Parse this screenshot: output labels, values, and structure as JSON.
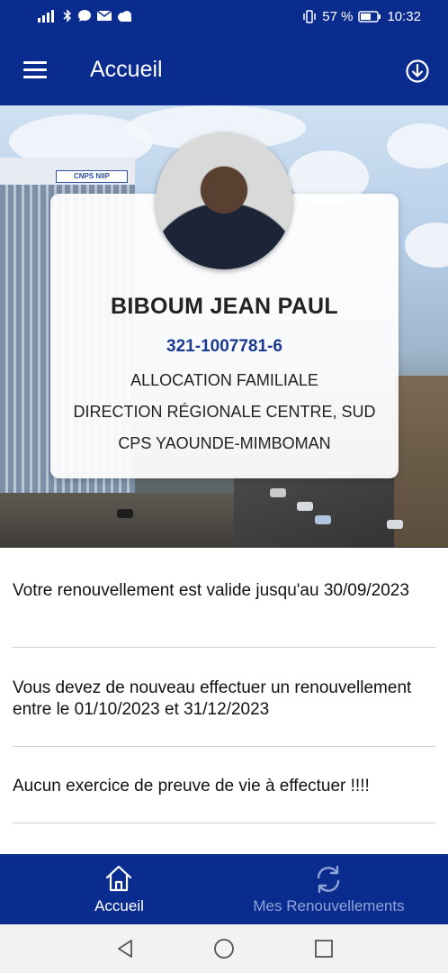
{
  "status_bar": {
    "battery_percent": "57 %",
    "time": "10:32"
  },
  "app_bar": {
    "title": "Accueil"
  },
  "profile": {
    "name": "BIBOUM JEAN PAUL",
    "id_number": "321-1007781-6",
    "benefit_type": "ALLOCATION FAMILIALE",
    "direction": "DIRECTION RÉGIONALE CENTRE, SUD",
    "centre": "CPS YAOUNDE-MIMBOMAN"
  },
  "building_sign": "CNPS NIIP",
  "messages": [
    "Votre renouvellement est valide jusqu'au 30/09/2023",
    "Vous devez de nouveau effectuer un renouvellement entre le 01/10/2023 et 31/12/2023",
    "Aucun exercice de preuve de vie à effectuer !!!!"
  ],
  "bottom_nav": {
    "items": [
      {
        "label": "Accueil",
        "icon": "home-icon",
        "active": true
      },
      {
        "label": "Mes Renouvellements",
        "icon": "refresh-icon",
        "active": false
      }
    ]
  },
  "colors": {
    "primary": "#0a2c8f",
    "id_text": "#1a3a8f",
    "nav_inactive": "#8ea3d6"
  }
}
